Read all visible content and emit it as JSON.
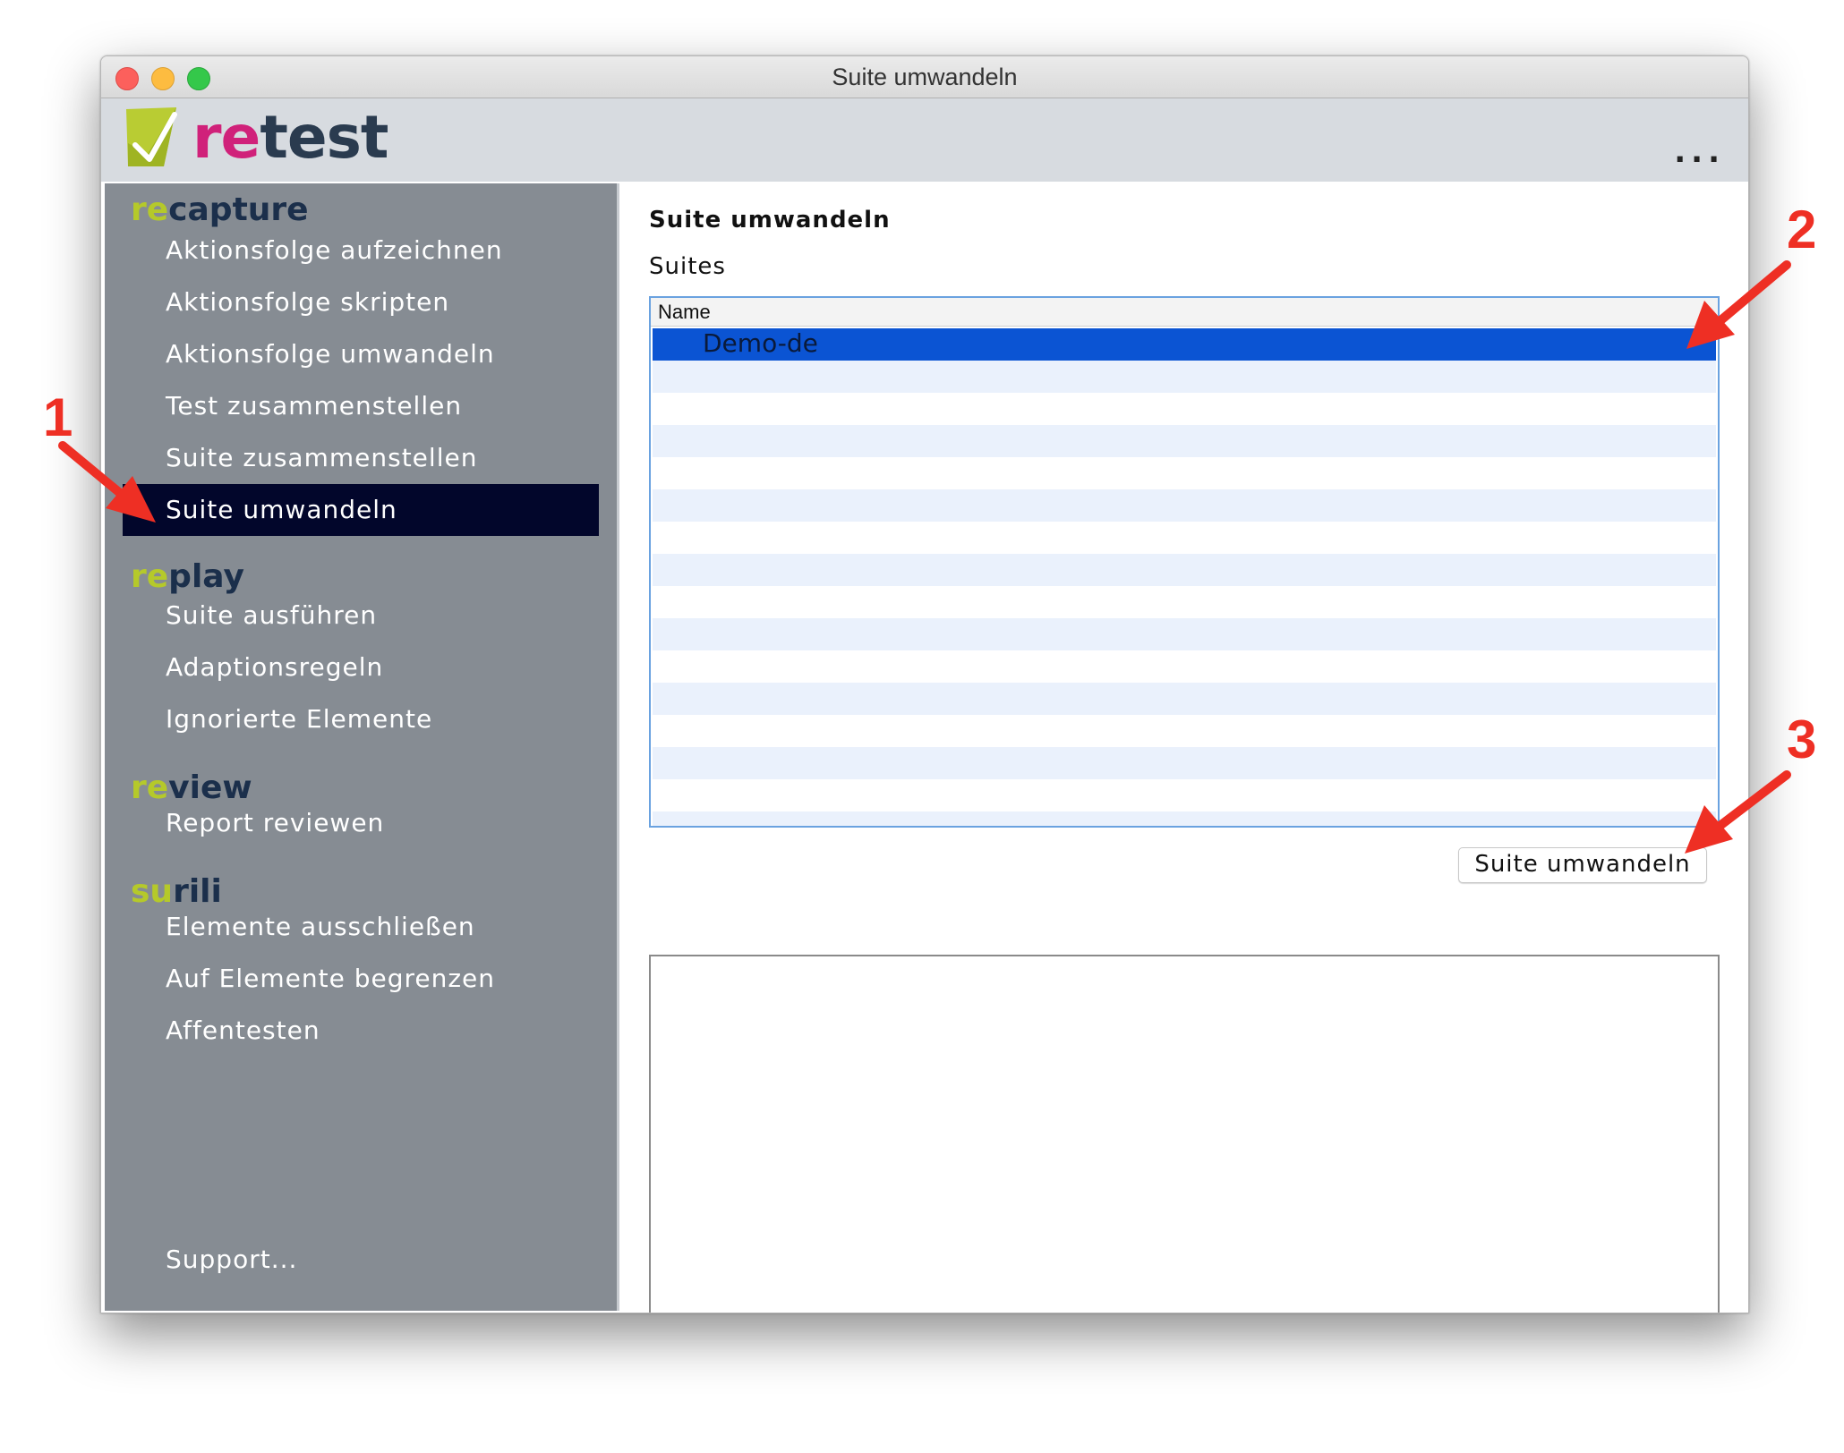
{
  "window": {
    "title": "Suite umwandeln"
  },
  "header": {
    "logo_prefix": "re",
    "logo_suffix": "test",
    "menu_label": "..."
  },
  "sidebar": {
    "sections": [
      {
        "prefix": "re",
        "rest": "capture"
      },
      {
        "prefix": "re",
        "rest": "play"
      },
      {
        "prefix": "re",
        "rest": "view"
      },
      {
        "prefix": "su",
        "rest": "rili"
      }
    ],
    "items": [
      {
        "label": "Aktionsfolge aufzeichnen"
      },
      {
        "label": "Aktionsfolge skripten"
      },
      {
        "label": "Aktionsfolge umwandeln"
      },
      {
        "label": "Test zusammenstellen"
      },
      {
        "label": "Suite zusammenstellen"
      },
      {
        "label": "Suite umwandeln",
        "active": true
      },
      {
        "label": "Suite ausführen"
      },
      {
        "label": "Adaptionsregeln"
      },
      {
        "label": "Ignorierte Elemente"
      },
      {
        "label": "Report reviewen"
      },
      {
        "label": "Elemente ausschließen"
      },
      {
        "label": "Auf Elemente begrenzen"
      },
      {
        "label": "Affentesten"
      }
    ],
    "support_label": "Support..."
  },
  "main": {
    "title": "Suite umwandeln",
    "list_label": "Suites",
    "table": {
      "column_header": "Name",
      "rows": [
        "Demo-de"
      ],
      "selected_index": 0
    },
    "convert_button_label": "Suite umwandeln"
  },
  "annotations": [
    "1",
    "2",
    "3"
  ],
  "colors": {
    "arrow": "#ee2f24",
    "selection": "#0b54d3",
    "sidebar_bg": "#868c93",
    "sidebar_active": "#02062b",
    "accent_green": "#b5c92a",
    "logo_magenta": "#d0217a"
  }
}
